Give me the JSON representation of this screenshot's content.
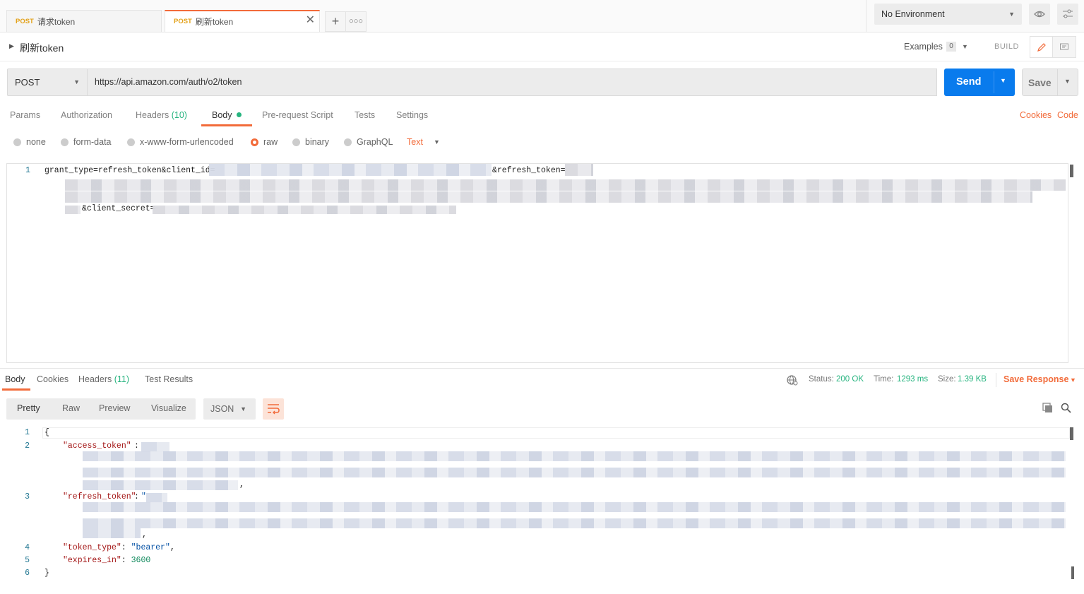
{
  "tabs": [
    {
      "method": "POST",
      "name": "请求token"
    },
    {
      "method": "POST",
      "name": "刷新token"
    }
  ],
  "environment": {
    "selected": "No Environment"
  },
  "request": {
    "title": "刷新token",
    "examples_label": "Examples",
    "examples_count": "0",
    "build_label": "BUILD",
    "method": "POST",
    "url": "https://api.amazon.com/auth/o2/token",
    "send_label": "Send",
    "save_label": "Save"
  },
  "request_tabs": {
    "params": "Params",
    "authorization": "Authorization",
    "headers": "Headers",
    "headers_count": "(10)",
    "body": "Body",
    "prerequest": "Pre-request Script",
    "tests": "Tests",
    "settings": "Settings",
    "cookies": "Cookies",
    "code": "Code"
  },
  "body_modes": {
    "none": "none",
    "form_data": "form-data",
    "urlencoded": "x-www-form-urlencoded",
    "raw": "raw",
    "binary": "binary",
    "graphql": "GraphQL",
    "raw_type": "Text"
  },
  "request_body": {
    "line_number": "1",
    "part1": "grant_type=refresh_token&client_id=",
    "part2": "&refresh_token=",
    "part3": "&client_secret="
  },
  "response_tabs": {
    "body": "Body",
    "cookies": "Cookies",
    "headers": "Headers",
    "headers_count": "(11)",
    "test_results": "Test Results"
  },
  "response_status": {
    "status_label": "Status:",
    "status_value": "200 OK",
    "time_label": "Time:",
    "time_value": "1293 ms",
    "size_label": "Size:",
    "size_value": "1.39 KB",
    "save_response": "Save Response"
  },
  "view_modes": {
    "pretty": "Pretty",
    "raw": "Raw",
    "preview": "Preview",
    "visualize": "Visualize",
    "format": "JSON"
  },
  "response_body": {
    "line_numbers": [
      "1",
      "2",
      "3",
      "4",
      "5",
      "6"
    ],
    "open_brace": "{",
    "close_brace": "}",
    "access_key": "\"access_token\"",
    "refresh_key": "\"refresh_token\"",
    "token_type_key": "\"token_type\"",
    "token_type_value": "\"bearer\"",
    "expires_key": "\"expires_in\"",
    "expires_value": "3600"
  },
  "colors": {
    "accent": "#f26b3a",
    "send_blue": "#097bed",
    "success_green": "#26b47f"
  }
}
